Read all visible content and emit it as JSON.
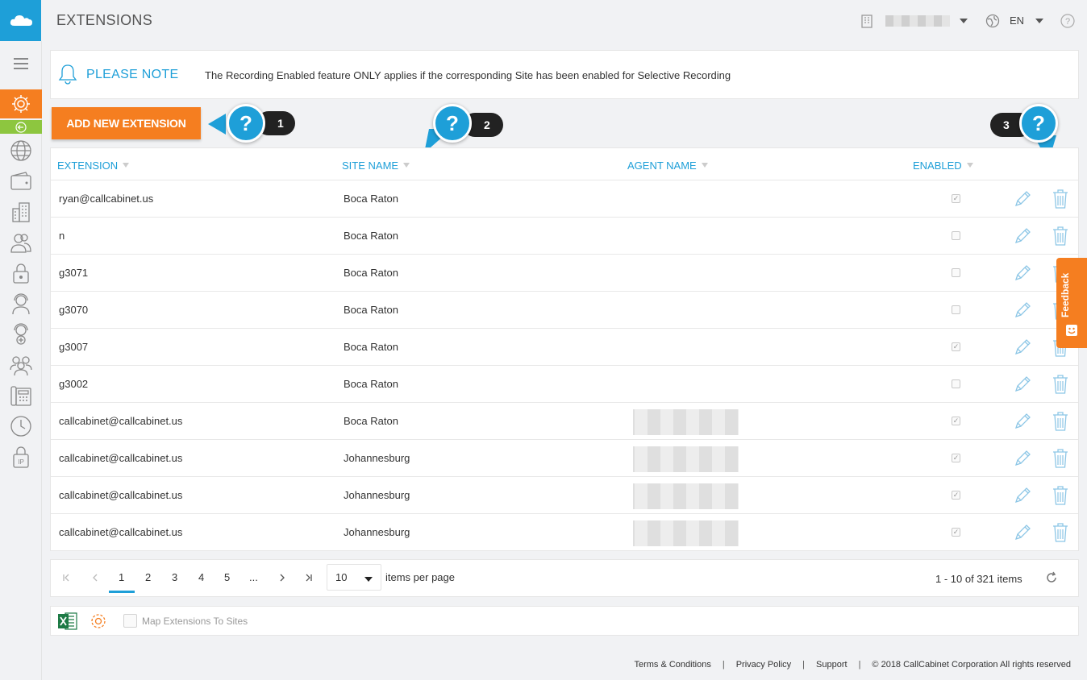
{
  "header": {
    "title": "EXTENSIONS",
    "language": "EN"
  },
  "note": {
    "title": "PLEASE NOTE",
    "text": "The Recording Enabled feature ONLY applies if the corresponding Site has been enabled for Selective Recording"
  },
  "actions": {
    "add_label": "ADD NEW EXTENSION"
  },
  "help_hints": [
    {
      "symbol": "?",
      "number": "1"
    },
    {
      "symbol": "?",
      "number": "2"
    },
    {
      "symbol": "?",
      "number": "3"
    }
  ],
  "table": {
    "columns": [
      "EXTENSION",
      "SITE NAME",
      "AGENT NAME",
      "ENABLED"
    ],
    "rows": [
      {
        "extension": "ryan@callcabinet.us",
        "site": "Boca Raton",
        "agent_redacted": false,
        "enabled": true
      },
      {
        "extension": "n",
        "site": "Boca Raton",
        "agent_redacted": false,
        "enabled": false
      },
      {
        "extension": "g3071",
        "site": "Boca Raton",
        "agent_redacted": false,
        "enabled": false
      },
      {
        "extension": "g3070",
        "site": "Boca Raton",
        "agent_redacted": false,
        "enabled": false
      },
      {
        "extension": "g3007",
        "site": "Boca Raton",
        "agent_redacted": false,
        "enabled": true
      },
      {
        "extension": "g3002",
        "site": "Boca Raton",
        "agent_redacted": false,
        "enabled": false
      },
      {
        "extension": "callcabinet@callcabinet.us",
        "site": "Boca Raton",
        "agent_redacted": true,
        "enabled": true
      },
      {
        "extension": "callcabinet@callcabinet.us",
        "site": "Johannesburg",
        "agent_redacted": true,
        "enabled": true
      },
      {
        "extension": "callcabinet@callcabinet.us",
        "site": "Johannesburg",
        "agent_redacted": true,
        "enabled": true
      },
      {
        "extension": "callcabinet@callcabinet.us",
        "site": "Johannesburg",
        "agent_redacted": true,
        "enabled": true
      }
    ]
  },
  "pagination": {
    "pages": [
      "1",
      "2",
      "3",
      "4",
      "5",
      "..."
    ],
    "current_page": "1",
    "page_size": "10",
    "items_per_page_label": "items per page",
    "info": "1 - 10 of 321 items"
  },
  "tools": {
    "map_label": "Map Extensions To Sites",
    "map_checked": false
  },
  "feedback": {
    "label": "Feedback"
  },
  "footer": {
    "links": [
      "Terms & Conditions",
      "Privacy Policy",
      "Support"
    ],
    "separator": "|",
    "copyright": "© 2018 CallCabinet Corporation All rights reserved"
  },
  "colors": {
    "accent_orange": "#f57e20",
    "accent_blue": "#1e9fd8",
    "accent_green": "#8dc63f"
  },
  "icons": {
    "sidebar": [
      "settings-icon",
      "globe-icon",
      "wallet-icon",
      "building-icon",
      "users-icon",
      "lock-icon",
      "agent-icon",
      "add-agent-icon",
      "group-icon",
      "phone-icon",
      "clock-icon",
      "ip-lock-icon"
    ]
  }
}
